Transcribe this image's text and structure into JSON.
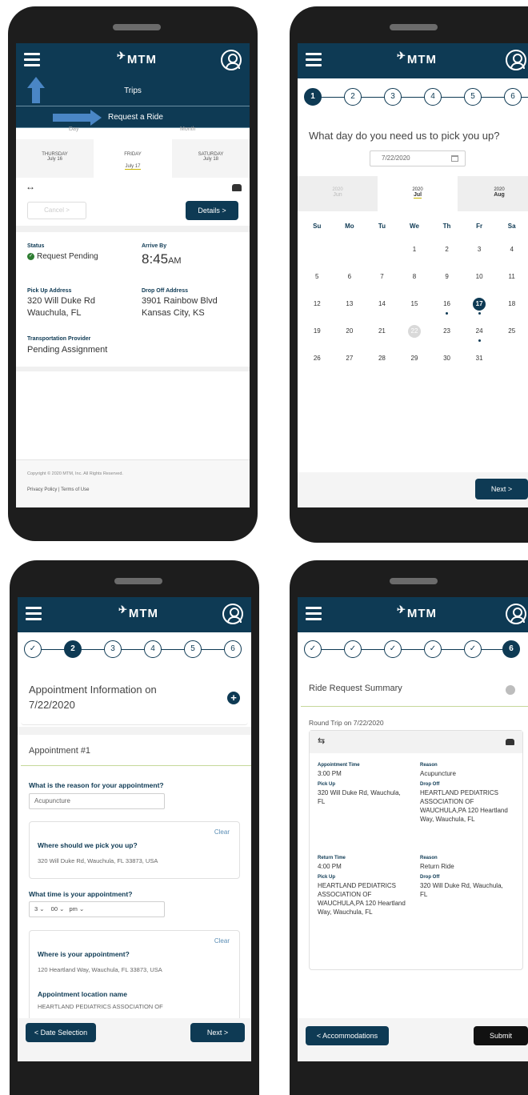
{
  "app": {
    "brand": "MTM"
  },
  "phone1": {
    "header_title": "Trips",
    "banner": "Request a Ride",
    "tabs": [
      "Day",
      "Month"
    ],
    "days": [
      {
        "weekday": "THURSDAY",
        "date": "July 16"
      },
      {
        "weekday": "FRIDAY",
        "date": "July 17"
      },
      {
        "weekday": "SATURDAY",
        "date": "July 18"
      }
    ],
    "cancel_label": "Cancel >",
    "details_label": "Details >",
    "status_label": "Status",
    "status_value": "Request Pending",
    "arrive_label": "Arrive By",
    "arrive_time": "8:45",
    "arrive_ampm": "AM",
    "pickup_label": "Pick Up Address",
    "pickup_line1": "320 Will Duke Rd",
    "pickup_line2": "Wauchula, FL",
    "dropoff_label": "Drop Off Address",
    "dropoff_line1": "3901 Rainbow Blvd",
    "dropoff_line2": "Kansas City, KS",
    "provider_label": "Transportation Provider",
    "provider_value": "Pending Assignment",
    "copyright": "Copyright © 2020 MTM, Inc. All Rights Reserved.",
    "privacy": "Privacy Policy",
    "terms": "Terms of Use"
  },
  "phone2": {
    "steps": [
      "1",
      "2",
      "3",
      "4",
      "5",
      "6"
    ],
    "question": "What day do you need us to pick you up?",
    "date_value": "7/22/2020",
    "months": [
      {
        "year": "2020",
        "month": "Jun"
      },
      {
        "year": "2020",
        "month": "Jul"
      },
      {
        "year": "2020",
        "month": "Aug"
      }
    ],
    "weekdays": [
      "Su",
      "Mo",
      "Tu",
      "We",
      "Th",
      "Fr",
      "Sa"
    ],
    "weeks": [
      [
        "",
        "",
        "",
        "1",
        "2",
        "3",
        "4"
      ],
      [
        "5",
        "6",
        "7",
        "8",
        "9",
        "10",
        "11"
      ],
      [
        "12",
        "13",
        "14",
        "15",
        "16",
        "17",
        "18"
      ],
      [
        "19",
        "20",
        "21",
        "22",
        "23",
        "24",
        "25"
      ],
      [
        "26",
        "27",
        "28",
        "29",
        "30",
        "31",
        ""
      ]
    ],
    "next_label": "Next >"
  },
  "phone3": {
    "steps": [
      "✓",
      "2",
      "3",
      "4",
      "5",
      "6"
    ],
    "title": "Appointment Information on 7/22/2020",
    "appointment_heading": "Appointment #1",
    "reason_question": "What is the reason for your appointment?",
    "reason_value": "Acupuncture",
    "clear_label": "Clear",
    "pickup_question": "Where should we pick you up?",
    "pickup_value": "320 Will Duke Rd, Wauchula, FL 33873, USA",
    "time_question": "What time is your appointment?",
    "time_hour": "3",
    "time_min": "00",
    "time_ampm": "pm",
    "where_question": "Where is your appointment?",
    "where_value": "120 Heartland Way, Wauchula, FL 33873, USA",
    "location_label": "Appointment location name",
    "location_value": "HEARTLAND PEDIATRICS ASSOCIATION OF",
    "back_label": "< Date Selection",
    "next_label": "Next >"
  },
  "phone4": {
    "steps": [
      "✓",
      "✓",
      "✓",
      "✓",
      "✓",
      "6"
    ],
    "summary_title": "Ride Request Summary",
    "trip_label": "Round Trip on 7/22/2020",
    "appt_time_label": "Appointment Time",
    "appt_time": "3:00 PM",
    "reason_label": "Reason",
    "reason_value": "Acupuncture",
    "pickup_label": "Pick Up",
    "pickup_value": "320 Will Duke Rd, Wauchula, FL",
    "dropoff_label": "Drop Off",
    "dropoff_value": "HEARTLAND PEDIATRICS ASSOCIATION OF WAUCHULA,PA 120 Heartland Way, Wauchula, FL",
    "return_time_label": "Return Time",
    "return_time": "4:00 PM",
    "return_reason_label": "Reason",
    "return_reason": "Return Ride",
    "return_pickup_label": "Pick Up",
    "return_pickup": "HEARTLAND PEDIATRICS ASSOCIATION OF WAUCHULA,PA 120 Heartland Way, Wauchula, FL",
    "return_dropoff_label": "Drop Off",
    "return_dropoff": "320 Will Duke Rd, Wauchula, FL",
    "back_label": "< Accommodations",
    "submit_label": "Submit"
  },
  "colors": {
    "primary": "#0e3a54",
    "accent": "#2e7d32",
    "arrow": "#4a86c5"
  }
}
